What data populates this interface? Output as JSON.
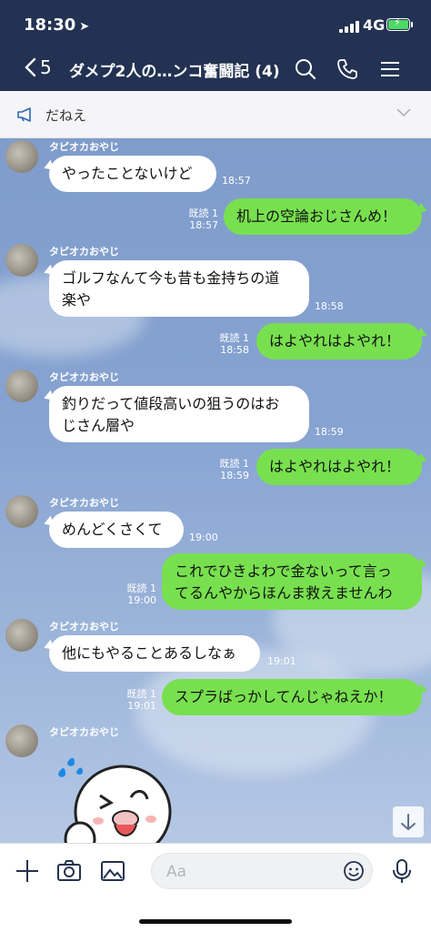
{
  "status": {
    "time": "18:30",
    "location_icon": "location-arrow-icon",
    "network": "4G"
  },
  "header": {
    "back_count": "5",
    "title": "ダメプ2人の…ンコ奮闘記 (4)",
    "icons": [
      "search-icon",
      "phone-icon",
      "menu-icon"
    ]
  },
  "announcement": {
    "text": "だねえ"
  },
  "messages": [
    {
      "sender": "タピオカおやじ",
      "text": "やったことないけど",
      "time": "18:57"
    },
    {
      "read": "既読 1",
      "time": "18:57",
      "text": "机上の空論おじさんめ！"
    },
    {
      "sender": "タピオカおやじ",
      "line1": "ゴルフなんて今も昔も金持ちの道",
      "line2": "楽や",
      "time": "18:58"
    },
    {
      "read": "既読 1",
      "time": "18:58",
      "text": "はよやれはよやれ！"
    },
    {
      "sender": "タピオカおやじ",
      "line1": "釣りだって値段高いの狙うのはお",
      "line2": "じさん層や",
      "time": "18:59"
    },
    {
      "read": "既読 1",
      "time": "18:59",
      "text": "はよやれはよやれ！"
    },
    {
      "sender": "タピオカおやじ",
      "text": "めんどくさくて",
      "time": "19:00"
    },
    {
      "read": "既読 1",
      "time": "19:00",
      "line1": "これでひきよわで金ないって言っ",
      "line2": "てるんやからほんま救えませんわ"
    },
    {
      "sender": "タピオカおやじ",
      "text": "他にもやることあるしなぁ",
      "time": "19:01"
    },
    {
      "read": "既読 1",
      "time": "19:01",
      "text": "スプラばっかしてんじゃねえか！"
    },
    {
      "sender": "タピオカおやじ"
    }
  ],
  "input": {
    "placeholder": "Aa"
  },
  "colors": {
    "header_bg": "#233252",
    "out_bubble": "#78e04f",
    "in_bubble": "#ffffff"
  }
}
